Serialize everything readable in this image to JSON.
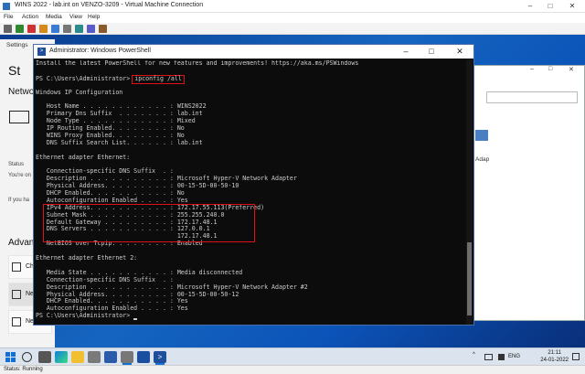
{
  "vm_window": {
    "title": "WINS 2022 - lab.int on VENZO-3209 - Virtual Machine Connection",
    "controls": [
      "–",
      "□",
      "✕"
    ]
  },
  "vm_menu": {
    "items": [
      "File",
      "Action",
      "Media",
      "View",
      "Help"
    ]
  },
  "settings_window": {
    "title": "Settings",
    "heading": "St",
    "network": "Netwo",
    "line1": "Status",
    "line2": "You're on",
    "line3": "If you ha",
    "advanced": "Advanc",
    "items": [
      "Cha",
      "Net",
      "Net"
    ]
  },
  "netconn_window": {
    "ctrl_min": "–",
    "ctrl_max": "□",
    "ctrl_close": "✕",
    "label1": "Adap"
  },
  "powershell": {
    "title": "Administrator: Windows PowerShell",
    "controls": [
      "–",
      "□",
      "✕"
    ],
    "prompt": "PS C:\\Users\\Administrator>",
    "command": "ipconfig /all",
    "lines": [
      "Install the latest PowerShell for new features and improvements! https://aka.ms/PSWindows",
      "",
      "__PROMPT__",
      "",
      "Windows IP Configuration",
      "",
      "   Host Name . . . . . . . . . . . . : WINS2022",
      "   Primary Dns Suffix  . . . . . . . : lab.int",
      "   Node Type . . . . . . . . . . . . : Mixed",
      "   IP Routing Enabled. . . . . . . . : No",
      "   WINS Proxy Enabled. . . . . . . . : No",
      "   DNS Suffix Search List. . . . . . : lab.int",
      "",
      "Ethernet adapter Ethernet:",
      "",
      "   Connection-specific DNS Suffix  . :",
      "   Description . . . . . . . . . . . : Microsoft Hyper-V Network Adapter",
      "   Physical Address. . . . . . . . . : 00-15-5D-00-50-10",
      "   DHCP Enabled. . . . . . . . . . . : No",
      "   Autoconfiguration Enabled . . . . : Yes",
      "   IPv4 Address. . . . . . . . . . . : 172.17.55.113(Preferred)",
      "   Subnet Mask . . . . . . . . . . . : 255.255.240.0",
      "   Default Gateway . . . . . . . . . : 172.17.48.1",
      "   DNS Servers . . . . . . . . . . . : 127.0.0.1",
      "                                       172.17.48.1",
      "   NetBIOS over Tcpip. . . . . . . . : Enabled",
      "",
      "Ethernet adapter Ethernet 2:",
      "",
      "   Media State . . . . . . . . . . . : Media disconnected",
      "   Connection-specific DNS Suffix  . :",
      "   Description . . . . . . . . . . . : Microsoft Hyper-V Network Adapter #2",
      "   Physical Address. . . . . . . . . : 00-15-5D-00-50-12",
      "   DHCP Enabled. . . . . . . . . . . : Yes",
      "   Autoconfiguration Enabled . . . . : Yes",
      "__PROMPT2__"
    ]
  },
  "taskbar": {
    "tray_lang": "ENG",
    "tray_arrow": "^",
    "time": "21:11",
    "date": "24-01-2022"
  },
  "status_bar": {
    "text": "Status: Running"
  },
  "colors": {
    "console_bg": "#0c0c0c",
    "console_fg": "#cccccc",
    "highlight": "#e0101a",
    "desktop_blue": "#1565c0"
  }
}
